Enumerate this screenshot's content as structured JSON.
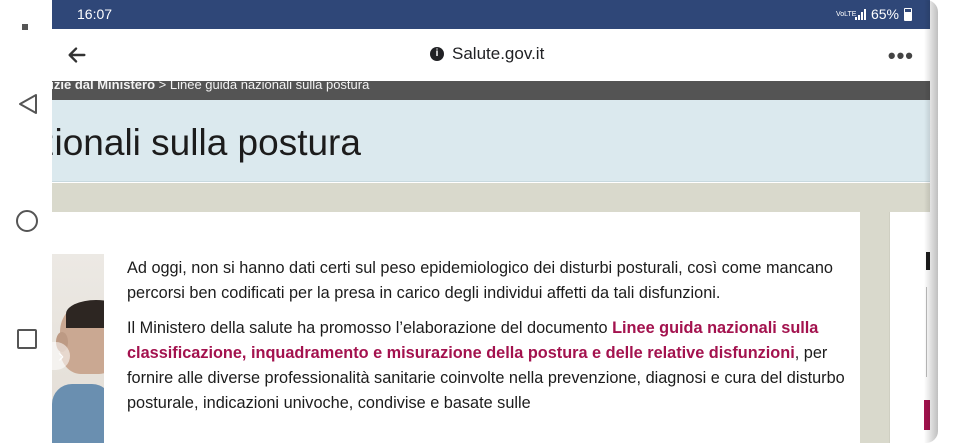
{
  "status_bar": {
    "time": "16:07",
    "volte": "VoLTE",
    "battery": "65%"
  },
  "browser": {
    "url": "Salute.gov.it",
    "more_label": "•••"
  },
  "breadcrumb": {
    "section": "otizie dal Ministero",
    "separator": ">",
    "current": "Linee guida nazionali sulla postura"
  },
  "page": {
    "title": "zionali sulla postura"
  },
  "article": {
    "paragraph1": "Ad oggi, non si hanno dati certi sul peso epidemiologico dei disturbi posturali, così come mancano percorsi ben codificati per la presa in carico degli individui affetti da tali disfunzioni.",
    "paragraph2_intro": "Il Ministero della salute ha promosso l’elaborazione del documento ",
    "document_link": "Linee guida nazionali sulla classificazione, inquadramento e misurazione della postura e delle relative disfunzioni",
    "paragraph2_rest": ", per fornire alle diverse professionalità sanitarie coinvolte nella prevenzione, diagnosi e cura del disturbo posturale, indicazioni univoche, condivise e basate sulle"
  },
  "colors": {
    "status_bar": "#2f4778",
    "breadcrumb": "#545454",
    "title_banner": "#dbe9ee",
    "link": "#a3124e",
    "content_bg": "#d9d9cc"
  },
  "icons": {
    "nav_back": "triangle-back-icon",
    "nav_home": "circle-home-icon",
    "nav_recent": "square-recents-icon",
    "browser_back": "arrow-left-icon",
    "site_info": "info-icon",
    "menu": "more-dots-icon"
  }
}
